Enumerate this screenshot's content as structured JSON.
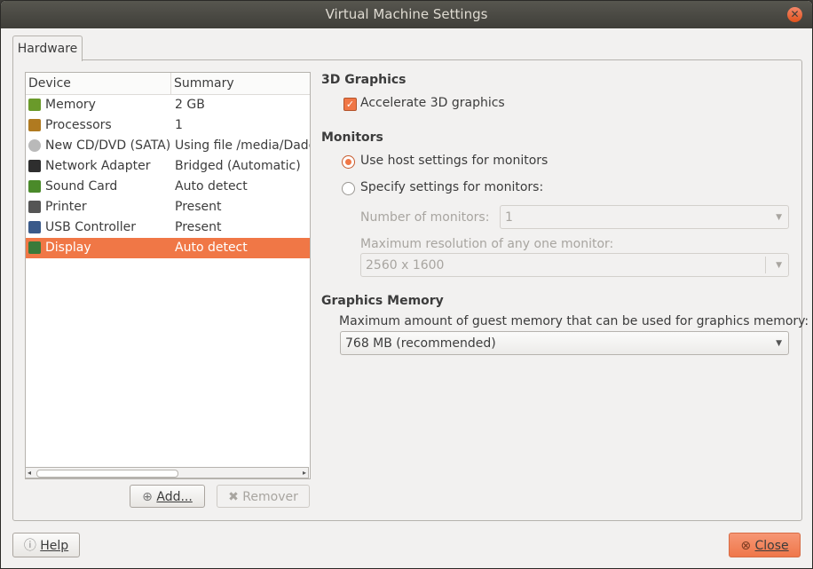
{
  "window": {
    "title": "Virtual Machine Settings"
  },
  "tabs": [
    {
      "label": "Hardware"
    }
  ],
  "device_list": {
    "columns": [
      "Device",
      "Summary"
    ],
    "rows": [
      {
        "icon": "memory-icon",
        "device": "Memory",
        "summary": "2 GB"
      },
      {
        "icon": "processor-icon",
        "device": "Processors",
        "summary": "1"
      },
      {
        "icon": "cd-dvd-icon",
        "device": "New CD/DVD (SATA)",
        "summary": "Using file /media/Dado"
      },
      {
        "icon": "network-adapter-icon",
        "device": "Network Adapter",
        "summary": "Bridged (Automatic)"
      },
      {
        "icon": "sound-card-icon",
        "device": "Sound Card",
        "summary": "Auto detect"
      },
      {
        "icon": "printer-icon",
        "device": "Printer",
        "summary": "Present"
      },
      {
        "icon": "usb-controller-icon",
        "device": "USB Controller",
        "summary": "Present"
      },
      {
        "icon": "display-icon",
        "device": "Display",
        "summary": "Auto detect",
        "selected": true
      }
    ],
    "add_button": "Add...",
    "remove_button": "Remover"
  },
  "graphics3d": {
    "heading": "3D Graphics",
    "accelerate_label": "Accelerate 3D graphics",
    "accelerate_checked": true
  },
  "monitors": {
    "heading": "Monitors",
    "use_host_label": "Use host settings for monitors",
    "specify_label": "Specify settings for monitors:",
    "selected": "use_host",
    "number_label": "Number of monitors:",
    "number_value": "1",
    "max_res_label": "Maximum resolution of any one monitor:",
    "max_res_value": "2560 x 1600"
  },
  "graphics_memory": {
    "heading": "Graphics Memory",
    "description": "Maximum amount of guest memory that can be used for graphics memory:",
    "value": "768 MB (recommended)"
  },
  "footer": {
    "help_label": "Help",
    "close_label": "Close"
  },
  "colors": {
    "accent": "#f07746",
    "titlebar": "#3f3e39",
    "background": "#f2f1f0"
  }
}
